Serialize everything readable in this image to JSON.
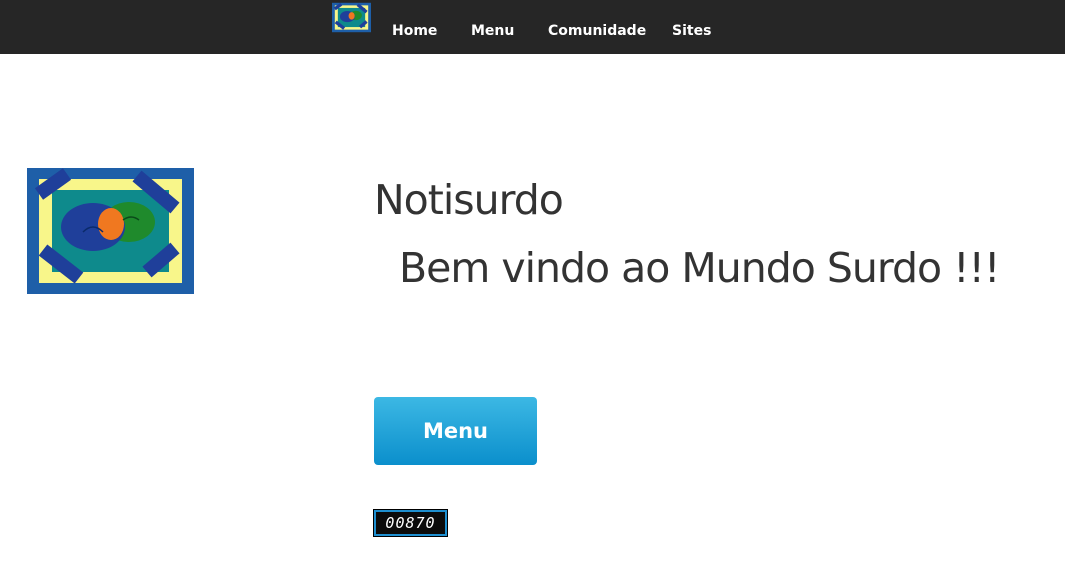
{
  "nav": {
    "logo_icon": "notisurdo-logo-icon",
    "items": [
      {
        "label": "Home"
      },
      {
        "label": "Menu"
      },
      {
        "label": "Comunidade"
      },
      {
        "label": "Sites"
      }
    ]
  },
  "hero": {
    "logo_icon": "notisurdo-logo-icon",
    "title": "Notisurdo",
    "subtitle": "Bem vindo ao Mundo Surdo !!!",
    "menu_button_label": "Menu"
  },
  "visit_counter": {
    "value": "00870"
  },
  "colors": {
    "topbar": "#262626",
    "button_top": "#3cb8e4",
    "button_bottom": "#0b8fcc",
    "text": "#333333",
    "logo_border": "#1e5fa8",
    "logo_yellow": "#f8f68a",
    "logo_teal": "#0e8a8c",
    "logo_blue": "#1f3f9a",
    "logo_green": "#1f8a2c",
    "logo_orange": "#f07820"
  }
}
